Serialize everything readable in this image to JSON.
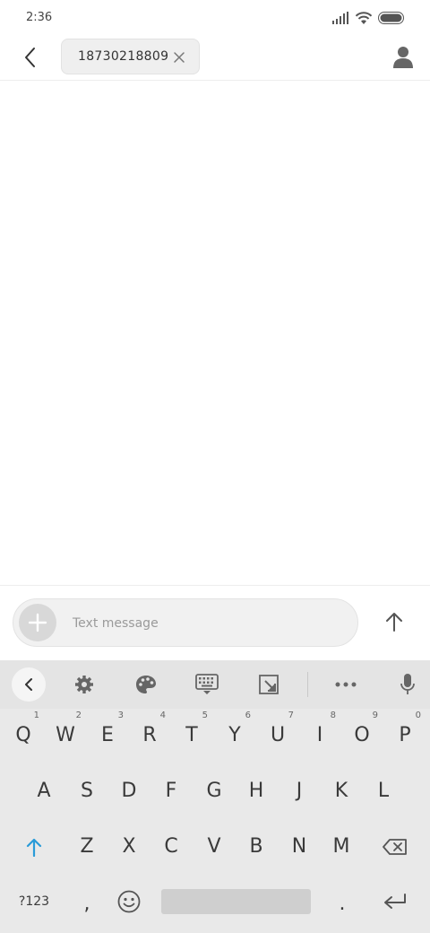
{
  "status_bar": {
    "time": "2:36",
    "icons": [
      "signal-icon",
      "wifi-icon",
      "battery-icon"
    ]
  },
  "header": {
    "back_icon": "chevron-left-icon",
    "recipient": "18730218809",
    "chip_close_icon": "close-icon",
    "contact_icon": "person-icon"
  },
  "composer": {
    "attach_icon": "plus-icon",
    "placeholder": "Text message",
    "send_icon": "arrow-up-icon"
  },
  "keyboard": {
    "toolbar": [
      "chevron-left-icon",
      "gear-icon",
      "palette-icon",
      "keyboard-icon",
      "resize-icon",
      "more-icon",
      "microphone-icon"
    ],
    "row1": [
      {
        "label": "Q",
        "hint": "1"
      },
      {
        "label": "W",
        "hint": "2"
      },
      {
        "label": "E",
        "hint": "3"
      },
      {
        "label": "R",
        "hint": "4"
      },
      {
        "label": "T",
        "hint": "5"
      },
      {
        "label": "Y",
        "hint": "6"
      },
      {
        "label": "U",
        "hint": "7"
      },
      {
        "label": "I",
        "hint": "8"
      },
      {
        "label": "O",
        "hint": "9"
      },
      {
        "label": "P",
        "hint": "0"
      }
    ],
    "row2": [
      "A",
      "S",
      "D",
      "F",
      "G",
      "H",
      "J",
      "K",
      "L"
    ],
    "row3": [
      "Z",
      "X",
      "C",
      "V",
      "B",
      "N",
      "M"
    ],
    "symbols_label": "?123",
    "comma_label": ",",
    "period_label": ".",
    "shift_color": "#2a9bd8"
  }
}
